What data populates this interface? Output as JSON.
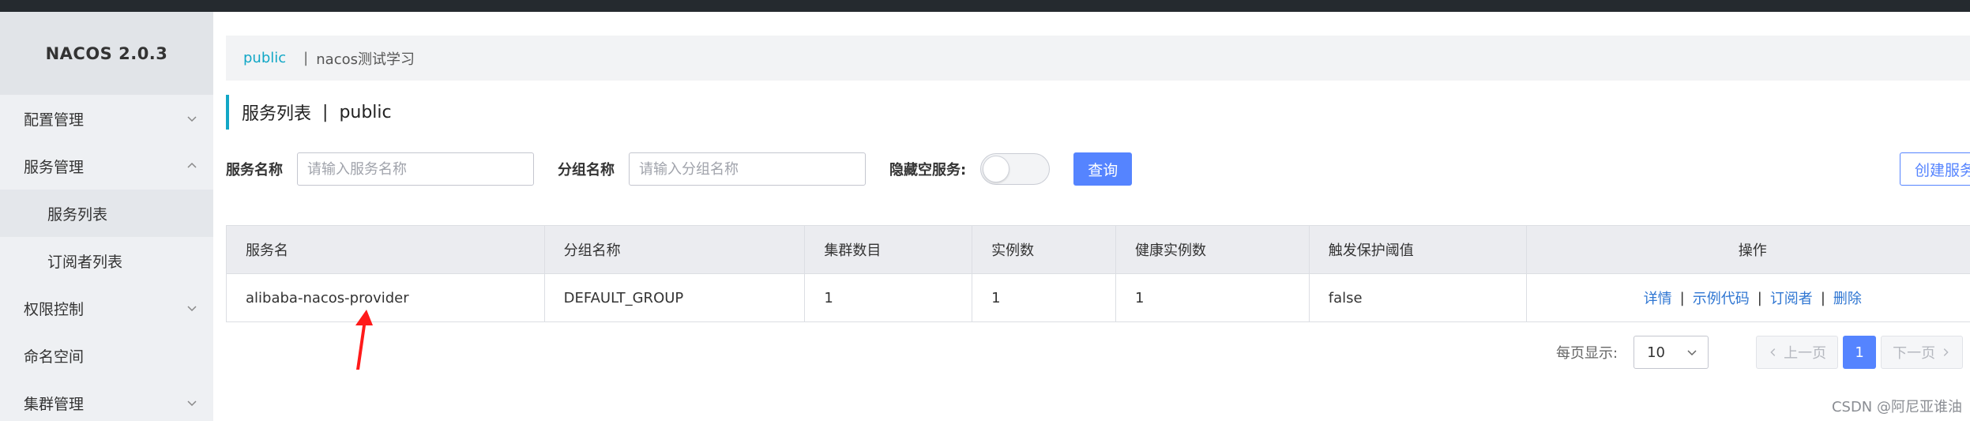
{
  "app": {
    "title": "NACOS 2.0.3"
  },
  "sidebar": {
    "items": [
      {
        "label": "配置管理",
        "chevron": "down"
      },
      {
        "label": "服务管理",
        "chevron": "up"
      },
      {
        "label": "服务列表",
        "sub": true,
        "active": true
      },
      {
        "label": "订阅者列表",
        "sub": true
      },
      {
        "label": "权限控制",
        "chevron": "down"
      },
      {
        "label": "命名空间"
      },
      {
        "label": "集群管理",
        "chevron": "down"
      }
    ]
  },
  "breadcrumb": {
    "namespace": "public",
    "separator": "|",
    "description": "nacos测试学习"
  },
  "page": {
    "title": "服务列表",
    "separator": "|",
    "namespace": "public"
  },
  "filters": {
    "service_name_label": "服务名称",
    "service_name_placeholder": "请输入服务名称",
    "group_name_label": "分组名称",
    "group_name_placeholder": "请输入分组名称",
    "hide_empty_label": "隐藏空服务:",
    "hide_empty_enabled": false,
    "query_button": "查询",
    "create_button": "创建服务"
  },
  "table": {
    "headers": [
      "服务名",
      "分组名称",
      "集群数目",
      "实例数",
      "健康实例数",
      "触发保护阈值",
      "操作"
    ],
    "rows": [
      {
        "service": "alibaba-nacos-provider",
        "group": "DEFAULT_GROUP",
        "clusters": "1",
        "instances": "1",
        "healthy": "1",
        "threshold": "false",
        "ops": [
          "详情",
          "示例代码",
          "订阅者",
          "删除"
        ]
      }
    ]
  },
  "pagination": {
    "per_page_label": "每页显示:",
    "per_page": "10",
    "prev": "上一页",
    "current": "1",
    "next": "下一页"
  },
  "watermark": "CSDN @阿尼亚谁油",
  "colors": {
    "accent": "#12a7c6",
    "primary": "#5584ff",
    "link": "#2f76d2",
    "arrow": "#ff1a1a"
  }
}
